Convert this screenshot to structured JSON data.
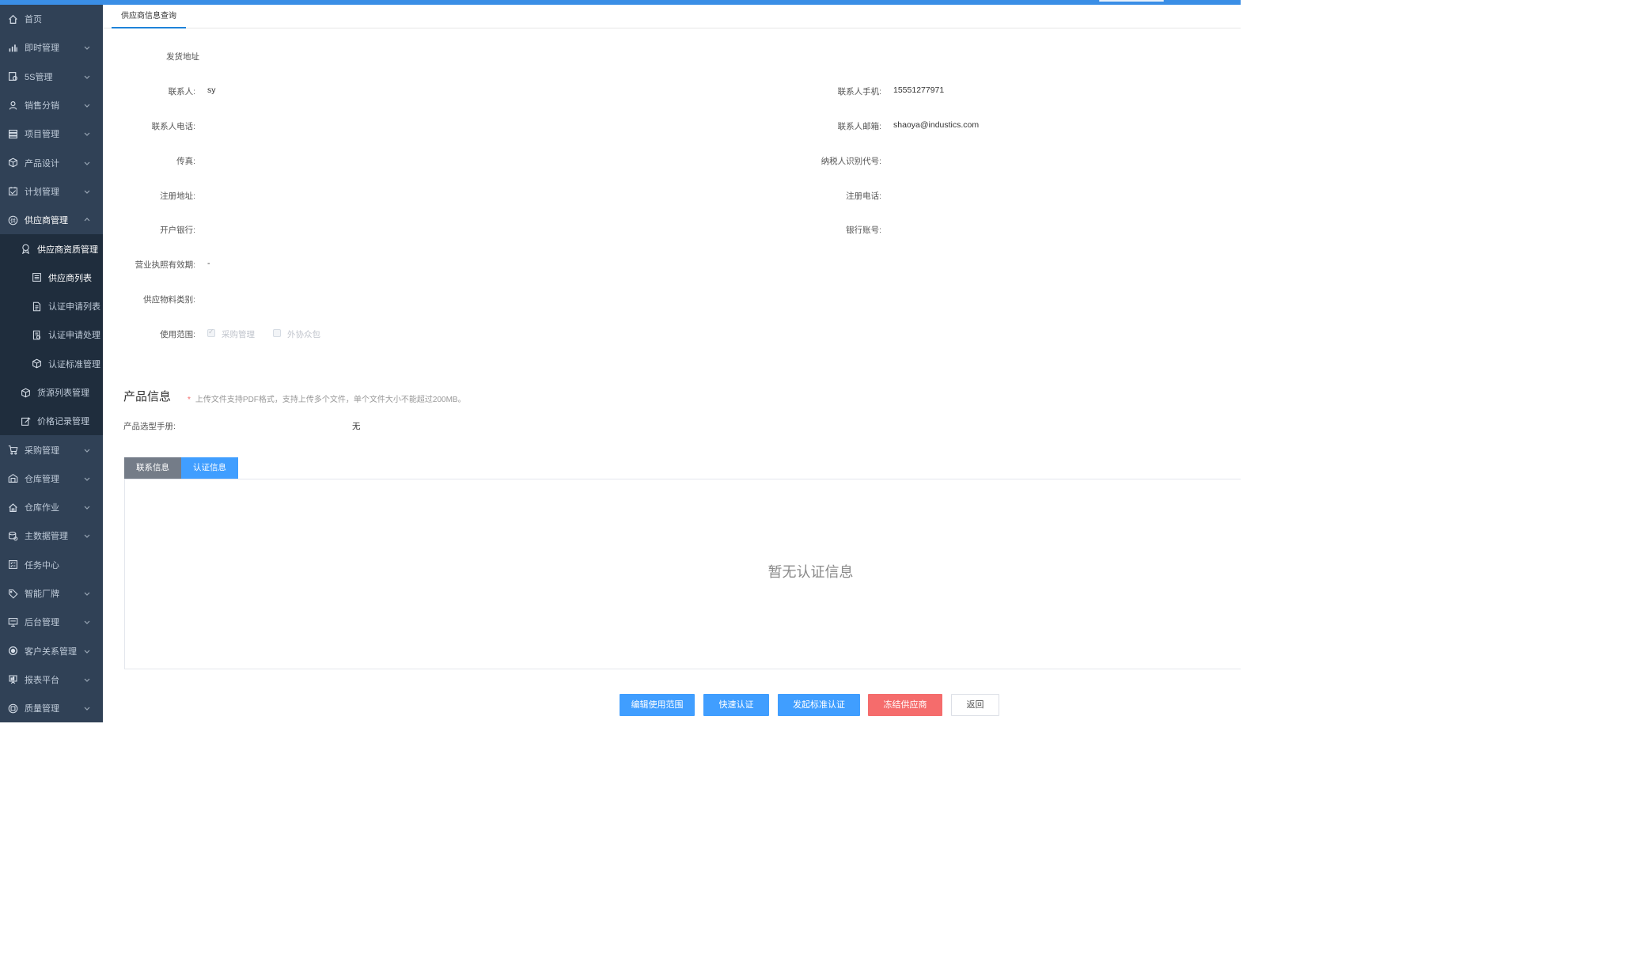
{
  "sidebar": {
    "items": [
      {
        "label": "首页",
        "icon": "home-icon"
      },
      {
        "label": "即时管理",
        "icon": "bar-chart-icon"
      },
      {
        "label": "5S管理",
        "icon": "checklist-icon"
      },
      {
        "label": "销售分销",
        "icon": "user-icon"
      },
      {
        "label": "项目管理",
        "icon": "stack-icon"
      },
      {
        "label": "产品设计",
        "icon": "cube-icon"
      },
      {
        "label": "计划管理",
        "icon": "calendar-icon"
      },
      {
        "label": "供应商管理",
        "icon": "supplier-icon"
      },
      {
        "label": "供应商资质管理",
        "icon": "badge-icon"
      },
      {
        "label": "供应商列表",
        "icon": "list-icon"
      },
      {
        "label": "认证申请列表",
        "icon": "document-icon"
      },
      {
        "label": "认证申请处理",
        "icon": "document-check-icon"
      },
      {
        "label": "认证标准管理",
        "icon": "cube-icon"
      },
      {
        "label": "货源列表管理",
        "icon": "cube-icon"
      },
      {
        "label": "价格记录管理",
        "icon": "edit-icon"
      },
      {
        "label": "采购管理",
        "icon": "cart-icon"
      },
      {
        "label": "仓库管理",
        "icon": "warehouse-icon"
      },
      {
        "label": "仓库作业",
        "icon": "house-icon"
      },
      {
        "label": "主数据管理",
        "icon": "database-icon"
      },
      {
        "label": "任务中心",
        "icon": "task-icon"
      },
      {
        "label": "智能厂牌",
        "icon": "tag-icon"
      },
      {
        "label": "后台管理",
        "icon": "monitor-icon"
      },
      {
        "label": "客户关系管理",
        "icon": "target-icon"
      },
      {
        "label": "报表平台",
        "icon": "presentation-icon"
      },
      {
        "label": "质量管理",
        "icon": "quality-icon"
      }
    ]
  },
  "tabs": {
    "current": "供应商信息查询"
  },
  "form": {
    "ship_address_label": "发货地址",
    "contact_label": "联系人:",
    "contact_value": "sy",
    "contact_mobile_label": "联系人手机:",
    "contact_mobile_value": "15551277971",
    "contact_phone_label": "联系人电话:",
    "contact_email_label": "联系人邮箱:",
    "contact_email_value": "shaoya@industics.com",
    "fax_label": "传真:",
    "tax_id_label": "纳税人识别代号:",
    "reg_address_label": "注册地址:",
    "reg_phone_label": "注册电话:",
    "bank_label": "开户银行:",
    "bank_account_label": "银行账号:",
    "license_validity_label": "营业执照有效期:",
    "license_validity_value": "-",
    "material_category_label": "供应物料类别:",
    "usage_scope_label": "使用范围:",
    "scope_purchase": "采购管理",
    "scope_outsource": "外协众包"
  },
  "product": {
    "title": "产品信息",
    "hint_star": "*",
    "hint": "上传文件支持PDF格式，支持上传多个文件，单个文件大小不能超过200MB。",
    "manual_label": "产品选型手册:",
    "manual_value": "无"
  },
  "info_tabs": {
    "contact": "联系信息",
    "cert": "认证信息"
  },
  "cert_panel": {
    "empty": "暂无认证信息"
  },
  "actions": {
    "edit_scope": "编辑使用范围",
    "quick_cert": "快速认证",
    "standard_cert": "发起标准认证",
    "freeze": "冻结供应商",
    "back": "返回"
  },
  "colors": {
    "sidebar": "#304156",
    "sidebar_sub": "#1f2d3d",
    "primary": "#409eff",
    "danger": "#f56c6c"
  }
}
